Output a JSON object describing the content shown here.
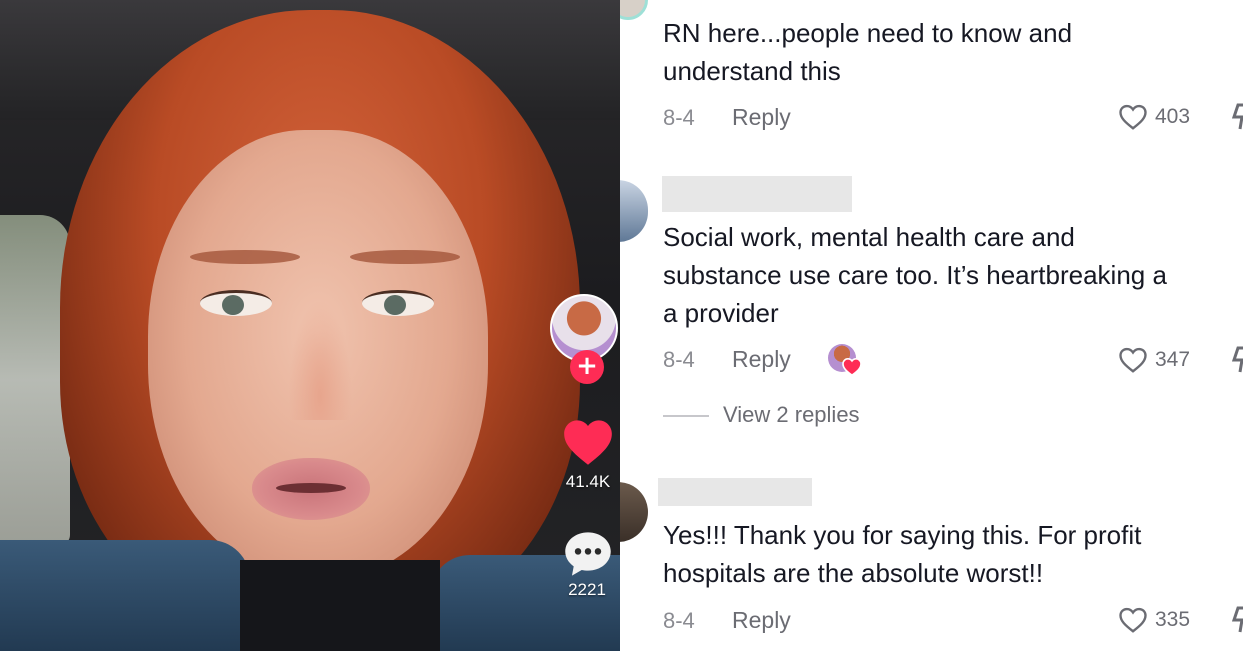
{
  "video": {
    "likes_count": "41.4K",
    "comments_count": "2221",
    "follow_symbol": "+"
  },
  "comments": [
    {
      "text": "RN here...people need to know and\nunderstand this",
      "date": "8-4",
      "reply_label": "Reply",
      "likes": "403"
    },
    {
      "text": "Social work, mental health care and\nsubstance use care too. It’s heartbreaking a\na provider",
      "date": "8-4",
      "reply_label": "Reply",
      "likes": "347",
      "view_replies": "View 2 replies"
    },
    {
      "text": "Yes!!! Thank you for saying this. For profit\nhospitals are the absolute worst!!",
      "date": "8-4",
      "reply_label": "Reply",
      "likes": "335"
    }
  ],
  "colors": {
    "accent_pink": "#fe2c55",
    "text_primary": "#161823",
    "text_secondary": "#8a8b91"
  },
  "icons": [
    "follow-plus-icon",
    "heart-icon",
    "comment-bubble-icon",
    "heart-outline-icon",
    "dislike-icon"
  ]
}
